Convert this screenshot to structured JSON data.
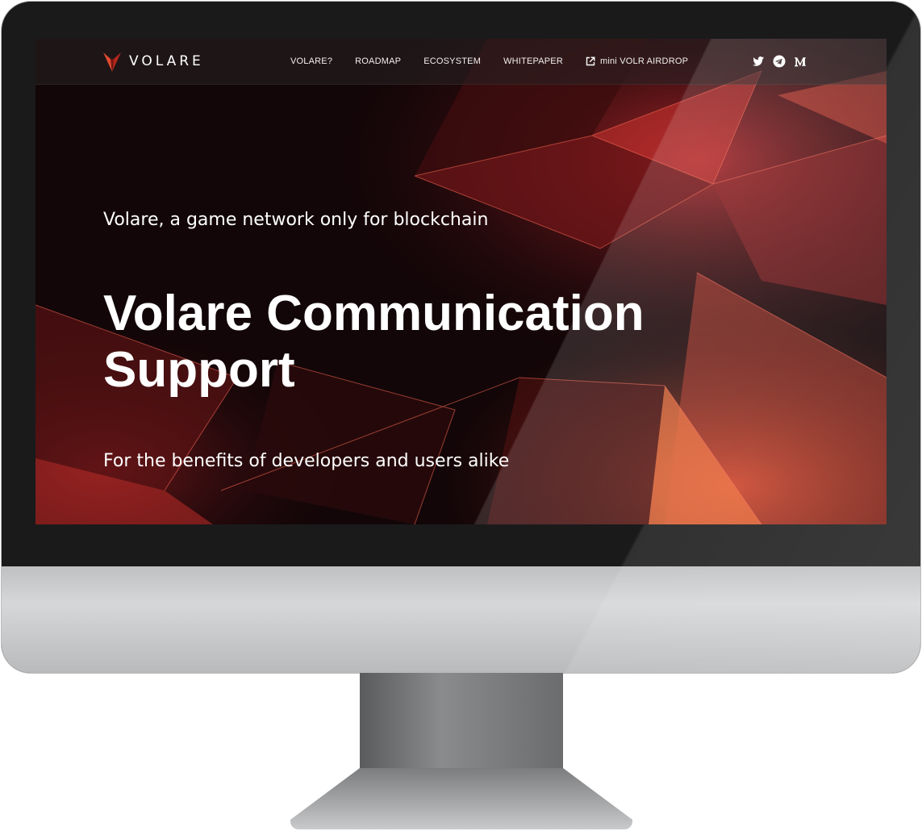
{
  "site": {
    "brand_name": "VOLARE",
    "brand_accent": "#d8432c"
  },
  "nav": {
    "links": [
      {
        "label": "VOLARE?"
      },
      {
        "label": "ROADMAP"
      },
      {
        "label": "ECOSYSTEM"
      },
      {
        "label": "WHITEPAPER"
      },
      {
        "label": "mini VOLR AIRDROP",
        "icon": "external-link-icon"
      }
    ],
    "social": [
      "twitter-icon",
      "telegram-icon",
      "medium-icon"
    ]
  },
  "hero": {
    "tagline": "Volare, a game network only for blockchain",
    "title_line1": "Volare Communication",
    "title_line2": "Support",
    "subtitle": "For the benefits of developers and users alike"
  }
}
